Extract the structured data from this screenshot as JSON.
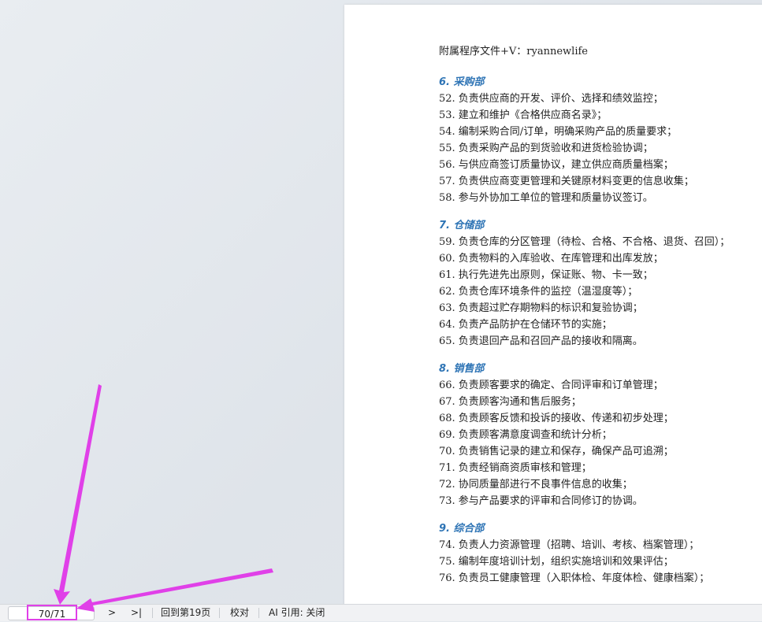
{
  "document": {
    "header": "附属程序文件+V：ryannewlife",
    "sections": [
      {
        "title": "6. 采购部",
        "items": [
          "52. 负责供应商的开发、评价、选择和绩效监控；",
          "53. 建立和维护《合格供应商名录》；",
          "54. 编制采购合同/订单，明确采购产品的质量要求；",
          "55. 负责采购产品的到货验收和进货检验协调；",
          "56. 与供应商签订质量协议，建立供应商质量档案；",
          "57. 负责供应商变更管理和关键原材料变更的信息收集；",
          "58. 参与外协加工单位的管理和质量协议签订。"
        ]
      },
      {
        "title": "7. 仓储部",
        "items": [
          "59. 负责仓库的分区管理（待检、合格、不合格、退货、召回）；",
          "60. 负责物料的入库验收、在库管理和出库发放；",
          "61. 执行先进先出原则，保证账、物、卡一致；",
          "62. 负责仓库环境条件的监控（温湿度等）；",
          "63. 负责超过贮存期物料的标识和复验协调；",
          "64. 负责产品防护在仓储环节的实施；",
          "65. 负责退回产品和召回产品的接收和隔离。"
        ]
      },
      {
        "title": "8. 销售部",
        "items": [
          "66. 负责顾客要求的确定、合同评审和订单管理；",
          "67. 负责顾客沟通和售后服务；",
          "68. 负责顾客反馈和投诉的接收、传递和初步处理；",
          "69. 负责顾客满意度调查和统计分析；",
          "70. 负责销售记录的建立和保存，确保产品可追溯；",
          "71. 负责经销商资质审核和管理；",
          "72. 协同质量部进行不良事件信息的收集；",
          "73. 参与产品要求的评审和合同修订的协调。"
        ]
      },
      {
        "title": "9. 综合部",
        "items": [
          "74. 负责人力资源管理（招聘、培训、考核、档案管理）；",
          "75. 编制年度培训计划，组织实施培训和效果评估；",
          "76. 负责员工健康管理（入职体检、年度体检、健康档案）；"
        ]
      }
    ]
  },
  "statusbar": {
    "page_indicator": "70/71",
    "next_label": ">",
    "last_label": ">|",
    "goto_label": "回到第19页",
    "proofread_label": "校对",
    "ai_label": "AI 引用: 关闭"
  },
  "annotation": {
    "color": "#e040e8"
  }
}
